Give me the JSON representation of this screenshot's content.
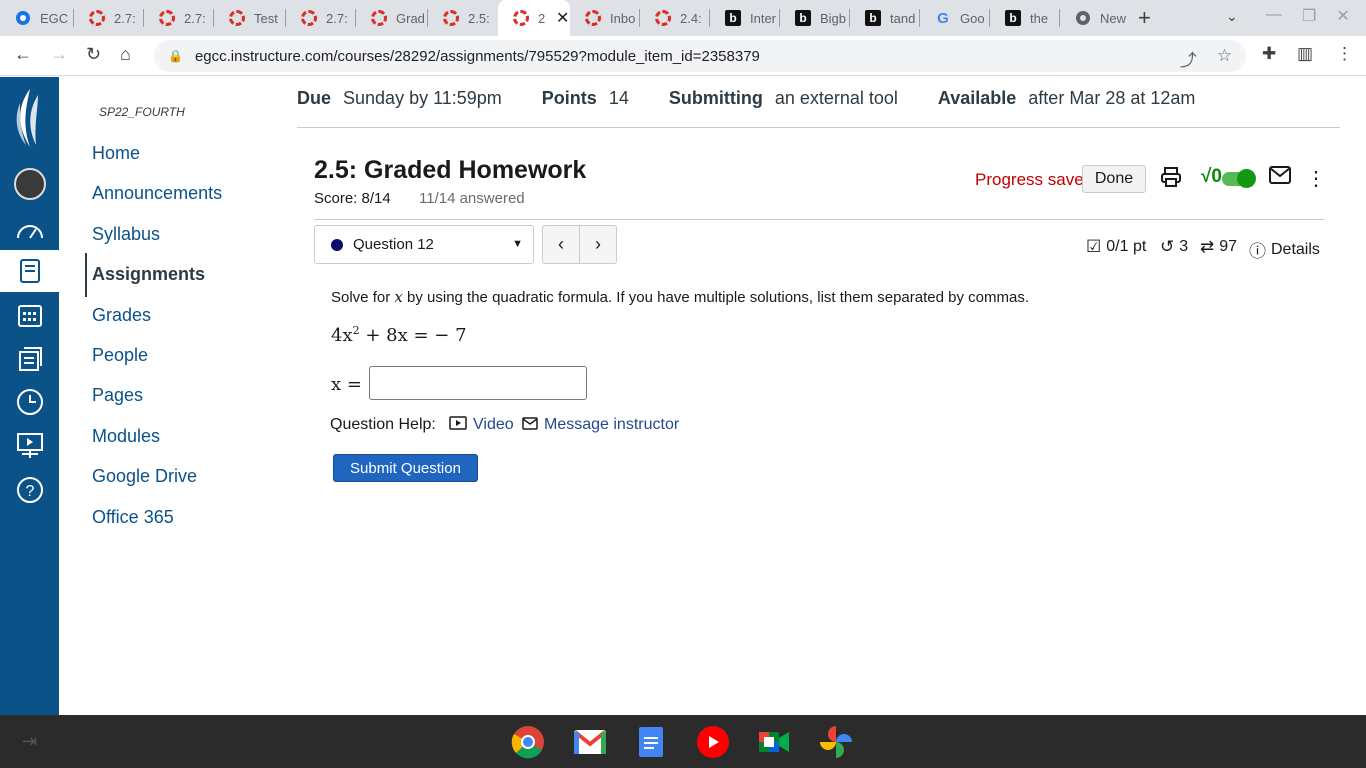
{
  "browser": {
    "tabs": [
      {
        "label": "EGC",
        "icon": "canvas-icon"
      },
      {
        "label": "2.7:",
        "icon": "spinner-icon"
      },
      {
        "label": "2.7:",
        "icon": "spinner-icon"
      },
      {
        "label": "Test",
        "icon": "spinner-icon"
      },
      {
        "label": "2.7:",
        "icon": "spinner-icon"
      },
      {
        "label": "Grad",
        "icon": "spinner-icon"
      },
      {
        "label": "2.5:",
        "icon": "spinner-icon"
      },
      {
        "label": "2",
        "icon": "spinner-icon"
      },
      {
        "label": "Inbo",
        "icon": "spinner-icon"
      },
      {
        "label": "2.4:",
        "icon": "spinner-icon"
      },
      {
        "label": "Inter",
        "icon": "bartleby-icon"
      },
      {
        "label": "Bigb",
        "icon": "bartleby-icon"
      },
      {
        "label": "tand",
        "icon": "bartleby-icon"
      },
      {
        "label": "Goo",
        "icon": "google-icon"
      },
      {
        "label": "the",
        "icon": "bartleby-icon"
      },
      {
        "label": "New",
        "icon": "chrome-icon"
      }
    ],
    "url": "egcc.instructure.com/courses/28292/assignments/795529?module_item_id=2358379"
  },
  "course_nav": {
    "term": "SP22_FOURTH",
    "items": [
      "Home",
      "Announcements",
      "Syllabus",
      "Assignments",
      "Grades",
      "People",
      "Pages",
      "Modules",
      "Google Drive",
      "Office 365"
    ],
    "active": "Assignments"
  },
  "assignment_meta": {
    "due_label": "Due",
    "due_value": "Sunday by 11:59pm",
    "points_label": "Points",
    "points_value": "14",
    "submitting_label": "Submitting",
    "submitting_value": "an external tool",
    "available_label": "Available",
    "available_value": "after Mar 28 at 12am"
  },
  "homework": {
    "title": "2.5: Graded Homework",
    "score": "Score: 8/14",
    "answered": "11/14 answered",
    "progress_saved": "Progress saved",
    "done_label": "Done",
    "math_toggle_label": "√0",
    "question_select": "Question 12",
    "points": "0/1 pt",
    "retries": "3",
    "attempts": "97",
    "details_label": "Details"
  },
  "question": {
    "prompt_before": "Solve for",
    "variable": "x",
    "prompt_after": "by using the quadratic formula. If you have multiple solutions, list them separated by commas.",
    "eq_part1": "4x",
    "eq_exp": "2",
    "eq_part2": " + 8x =  − 7",
    "answer_label": "x =",
    "answer_value": "",
    "help_label": "Question Help:",
    "video_label": "Video",
    "message_label": "Message instructor",
    "submit_label": "Submit Question"
  },
  "colors": {
    "canvas_nav": "#0b5288",
    "link": "#0b5288",
    "progress_saved": "#c00000",
    "submit": "#2066c1"
  }
}
